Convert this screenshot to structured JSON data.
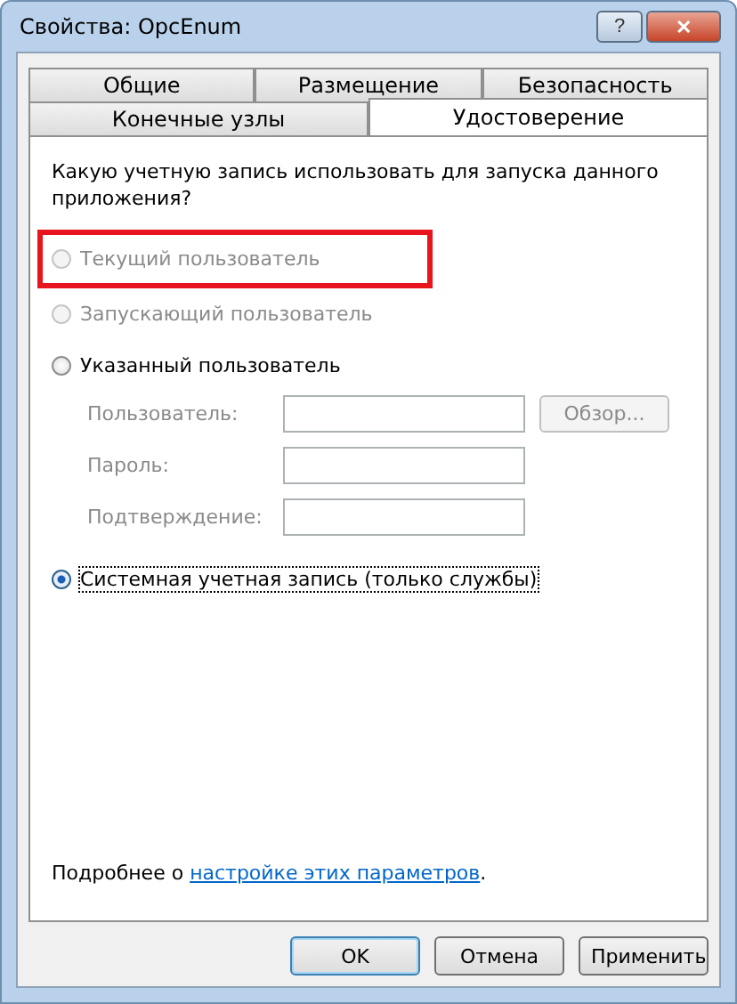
{
  "window": {
    "title": "Свойства: OpcEnum",
    "help_button": "?",
    "close_button": "✕"
  },
  "tab_rows": [
    [
      {
        "label": "Общие",
        "selected": false
      },
      {
        "label": "Размещение",
        "selected": false
      },
      {
        "label": "Безопасность",
        "selected": false
      }
    ],
    [
      {
        "label": "Конечные узлы",
        "selected": false
      },
      {
        "label": "Удостоверение",
        "selected": true
      }
    ]
  ],
  "question": "Какую учетную запись использовать для запуска данного приложения?",
  "options": [
    {
      "label": "Текущий пользователь",
      "selected": false,
      "disabled": true,
      "highlighted": true
    },
    {
      "label": "Запускающий пользователь",
      "selected": false,
      "disabled": true,
      "highlighted": false
    },
    {
      "label": "Указанный пользователь",
      "selected": false,
      "disabled": false,
      "highlighted": false,
      "kind": "with_fields"
    },
    {
      "label": "Системная учетная запись (только службы)",
      "selected": true,
      "disabled": false,
      "highlighted": false
    }
  ],
  "fields": [
    {
      "label": "Пользователь:",
      "disabled": true,
      "button": "Обзор..."
    },
    {
      "label": "Пароль:",
      "disabled": true
    },
    {
      "label": "Подтверждение:",
      "disabled": true
    }
  ],
  "footer": {
    "text": "Подробнее о ",
    "link": "настройке этих параметров",
    "after": "."
  },
  "buttons": [
    {
      "label": "OK",
      "default": true
    },
    {
      "label": "Отмена",
      "default": false
    },
    {
      "label": "Применить",
      "default": false
    }
  ]
}
